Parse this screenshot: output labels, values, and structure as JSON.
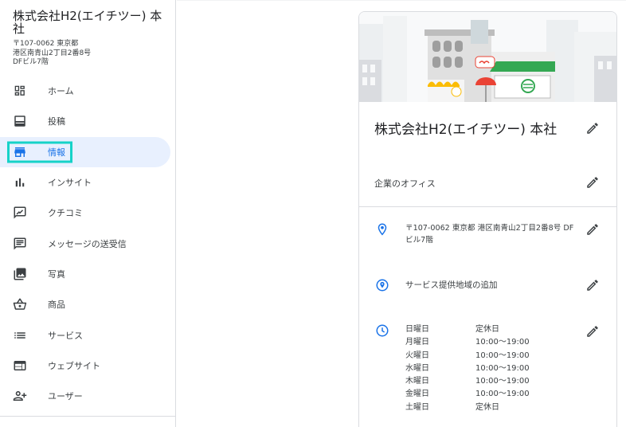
{
  "business": {
    "name": "株式会社H2(エイチツー) 本社",
    "address_lines": [
      "〒107-0062 東京都",
      "港区南青山2丁目2番8号",
      "DFビル7階"
    ]
  },
  "nav": {
    "items": [
      {
        "label": "ホーム",
        "icon": "dashboard-icon"
      },
      {
        "label": "投稿",
        "icon": "posts-icon"
      },
      {
        "label": "情報",
        "icon": "storefront-icon",
        "active": true
      },
      {
        "label": "インサイト",
        "icon": "bar-chart-icon"
      },
      {
        "label": "クチコミ",
        "icon": "review-icon"
      },
      {
        "label": "メッセージの送受信",
        "icon": "message-icon"
      },
      {
        "label": "写真",
        "icon": "photo-library-icon"
      },
      {
        "label": "商品",
        "icon": "shopping-basket-icon"
      },
      {
        "label": "サービス",
        "icon": "list-icon"
      },
      {
        "label": "ウェブサイト",
        "icon": "web-icon"
      },
      {
        "label": "ユーザー",
        "icon": "add-person-icon"
      }
    ]
  },
  "card": {
    "title": "株式会社H2(エイチツー) 本社",
    "category": "企業のオフィス",
    "address": "〒107-0062 東京都 港区南青山2丁目2番8号 DFビル7階",
    "service_area": "サービス提供地域の追加",
    "hours": [
      {
        "day": "日曜日",
        "time": "定休日"
      },
      {
        "day": "月曜日",
        "time": "10:00～19:00"
      },
      {
        "day": "火曜日",
        "time": "10:00～19:00"
      },
      {
        "day": "水曜日",
        "time": "10:00～19:00"
      },
      {
        "day": "木曜日",
        "time": "10:00～19:00"
      },
      {
        "day": "金曜日",
        "time": "10:00～19:00"
      },
      {
        "day": "土曜日",
        "time": "定休日"
      }
    ]
  },
  "colors": {
    "accent": "#1a73e8",
    "active_bg": "#e8f0fe",
    "highlight_box": "#16d2c8",
    "icon": "#3c4043"
  }
}
